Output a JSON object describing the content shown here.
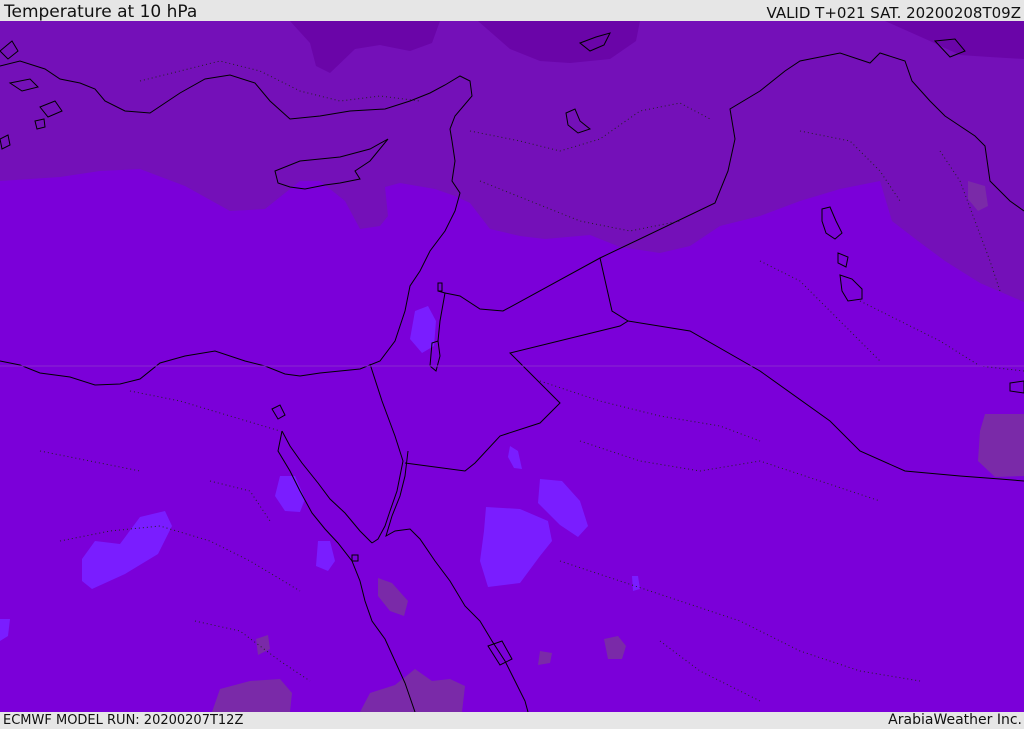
{
  "header": {
    "title": "Temperature at 10 hPa",
    "valid": "VALID T+021 SAT. 20200208T09Z"
  },
  "footer": {
    "model_run": "ECMWF MODEL RUN: 20200207T12Z",
    "credit": "ArabiaWeather Inc."
  },
  "colors": {
    "base": "#7b00d9",
    "north_band": "#7410b8",
    "cold_core": "#6a05a8",
    "warm_patch": "#7a1dff",
    "cool_patch": "#7a2aa8",
    "coastline": "#000000"
  }
}
